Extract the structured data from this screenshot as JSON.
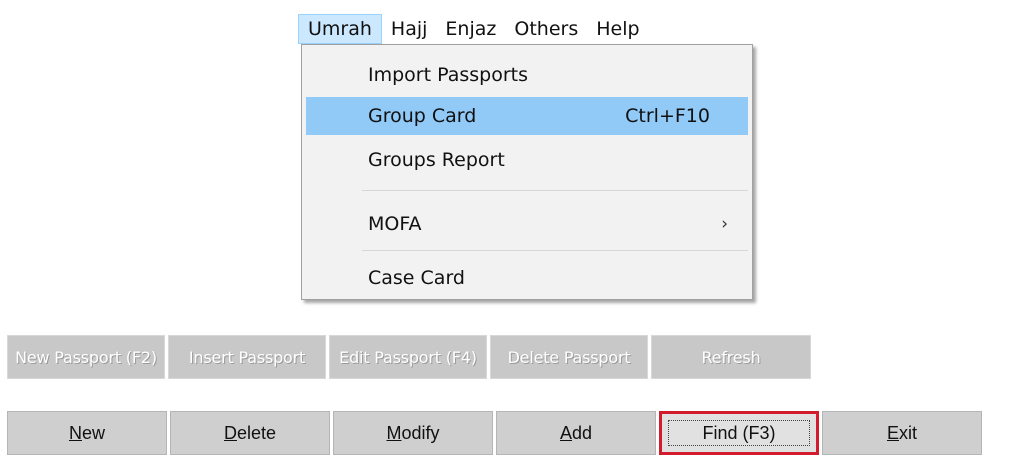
{
  "menubar": {
    "items": [
      {
        "label": "Umrah"
      },
      {
        "label": "Hajj"
      },
      {
        "label": "Enjaz"
      },
      {
        "label": "Others"
      },
      {
        "label": "Help"
      }
    ]
  },
  "dropdown": {
    "items": [
      {
        "label": "Import Passports"
      },
      {
        "label": "Group Card",
        "shortcut": "Ctrl+F10"
      },
      {
        "label": "Groups Report"
      },
      {
        "label": "MOFA",
        "submenu_indicator": "›"
      },
      {
        "label": "Case Card"
      }
    ]
  },
  "toolbar_top": {
    "new_passport": "New Passport (F2)",
    "insert_passport": "Insert Passport",
    "edit_passport": "Edit Passport (F4)",
    "delete_passport": "Delete Passport",
    "refresh": "Refresh"
  },
  "toolbar_bottom": {
    "new": {
      "mnemonic": "N",
      "rest": "ew"
    },
    "delete": {
      "mnemonic": "D",
      "rest": "elete"
    },
    "modify": {
      "mnemonic": "M",
      "rest": "odify"
    },
    "add": {
      "mnemonic": "A",
      "rest": "dd"
    },
    "find": "Find (F3)",
    "exit": {
      "mnemonic": "E",
      "rest": "xit"
    }
  },
  "colors": {
    "menu_highlight": "#91c9f7",
    "menubar_active": "#cce8ff",
    "find_outline": "#d21b2c",
    "disabled_button": "#c8c8c8",
    "button_face": "#cfcfcf"
  }
}
